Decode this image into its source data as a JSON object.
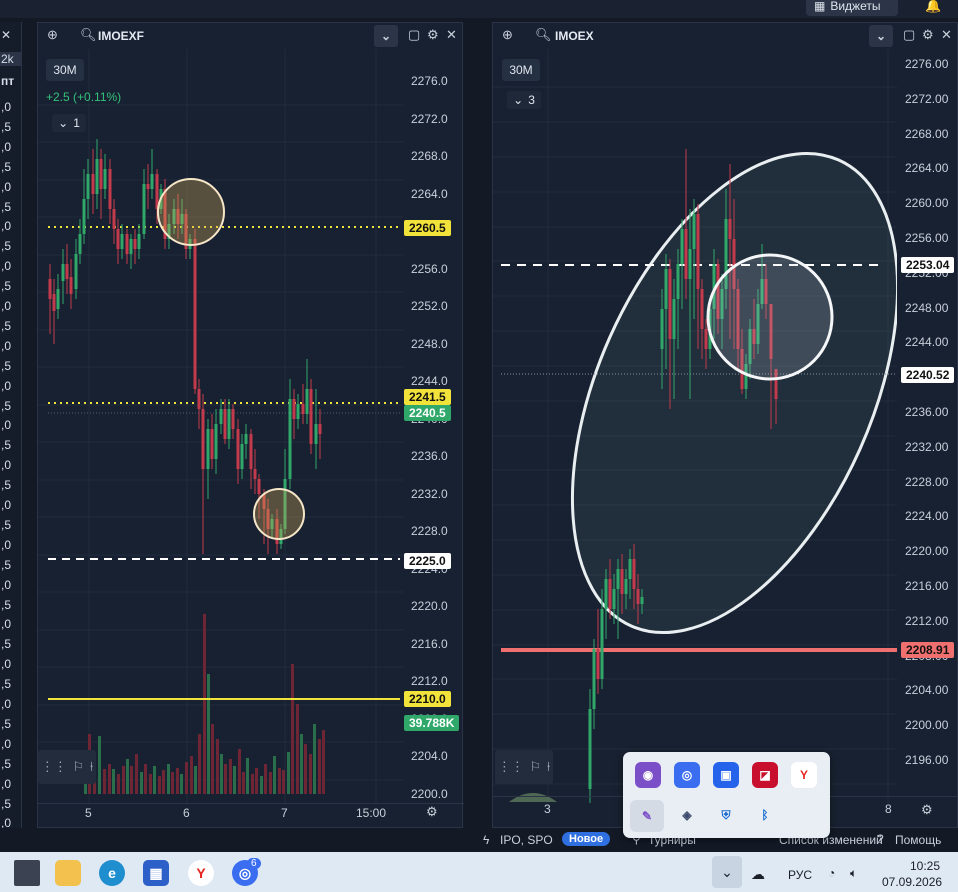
{
  "top": {
    "widgets_label": "Виджеты"
  },
  "left_sliver": {
    "tab": "2k",
    "header": "пт",
    "rows": [
      ",0",
      ",5",
      ",0",
      ",5",
      ",0",
      ",5",
      ",0",
      ",5",
      ",0",
      ",5",
      ",0",
      ",5",
      ",0",
      ",5",
      ",0",
      ",5",
      ",0",
      ",5",
      ",0",
      ",5",
      ",0",
      ",5",
      ",0",
      ",5",
      ",0",
      ",5",
      ",0",
      ",5",
      ",0",
      ",5",
      ",0",
      ",5",
      ",0",
      ",5",
      ",0",
      ",5",
      ",0",
      ",5"
    ]
  },
  "panel_left": {
    "ticker": "IMOEXF",
    "timeframe": "30M",
    "change": "+2.5 (+0.11%)",
    "indicator_count": "1",
    "price_ticks": [
      "2276.0",
      "2272.0",
      "2268.0",
      "2264.0",
      "2260.0",
      "2256.0",
      "2252.0",
      "2248.0",
      "2244.0",
      "2240.0",
      "2236.0",
      "2232.0",
      "2228.0",
      "2224.0",
      "2220.0",
      "2216.0",
      "2212.0",
      "2208.0",
      "2204.0",
      "2200.0"
    ],
    "labels": {
      "l2260": "2260.5",
      "l2241": "2241.5",
      "l2240": "2240.5",
      "l2225": "2225.0",
      "l2210": "2210.0",
      "volume": "39.788K"
    },
    "x_labels": [
      "5",
      "6",
      "7",
      "15:00"
    ]
  },
  "panel_right": {
    "ticker": "IMOEX",
    "timeframe": "30M",
    "indicator_count": "3",
    "price_ticks": [
      "2276.00",
      "2272.00",
      "2268.00",
      "2264.00",
      "2260.00",
      "2256.00",
      "2252.00",
      "2248.00",
      "2244.00",
      "2240.00",
      "2236.00",
      "2232.00",
      "2228.00",
      "2224.00",
      "2220.00",
      "2216.00",
      "2212.00",
      "2208.00",
      "2204.00",
      "2200.00",
      "2196.00"
    ],
    "labels": {
      "l2253": "2253.04",
      "l2240": "2240.52",
      "l2208": "2208.91"
    },
    "x_labels": [
      "3",
      "8"
    ]
  },
  "status": {
    "ipo": "IPO, SPO",
    "new_badge": "Новое",
    "tournaments": "Турниры",
    "changelog": "Список изменений",
    "help": "Помощь"
  },
  "taskbar": {
    "yandex_badge": "6",
    "lang": "РУС",
    "time": "10:25",
    "date": "07.09.2026"
  },
  "colors": {
    "up": "#2fa86a",
    "down": "#c23a4b",
    "yellow": "#f2e33b",
    "red_line": "#f07070",
    "accent_blue": "#2f6fe0"
  }
}
